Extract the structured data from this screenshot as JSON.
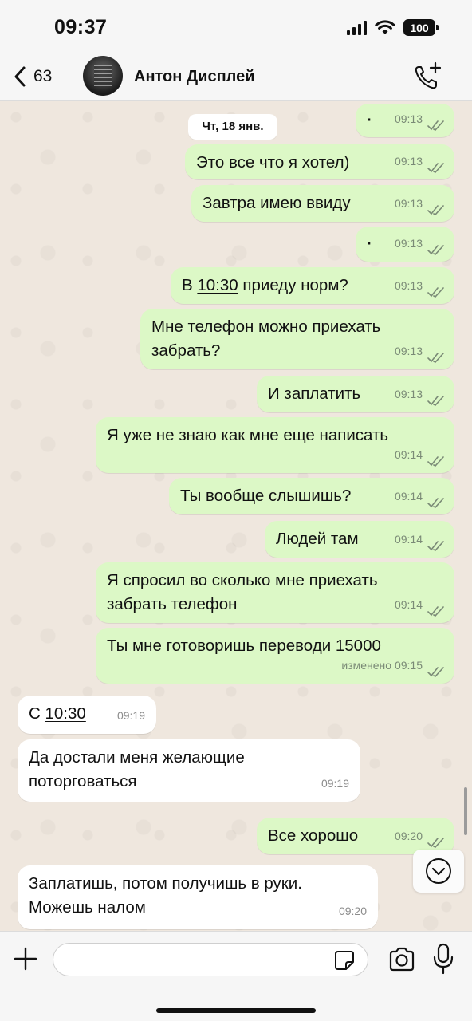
{
  "status_bar": {
    "time": "09:37",
    "battery": "100"
  },
  "header": {
    "back_count": "63",
    "contact_name": "Антон Дисплей"
  },
  "chat": {
    "date_separator": "Чт, 18 янв.",
    "messages": [
      {
        "dir": "out",
        "text": "·",
        "time": "09:13"
      },
      {
        "dir": "out",
        "text": "Это все что я хотел)",
        "time": "09:13"
      },
      {
        "dir": "out",
        "text": "Завтра имею ввиду",
        "time": "09:13"
      },
      {
        "dir": "out",
        "text": "·",
        "time": "09:13"
      },
      {
        "dir": "out",
        "text_before": "В ",
        "link": "10:30",
        "text_after": " приеду норм?",
        "time": "09:13"
      },
      {
        "dir": "out",
        "text": "Мне телефон можно приехать забрать?",
        "time": "09:13"
      },
      {
        "dir": "out",
        "text": "И заплатить",
        "time": "09:13"
      },
      {
        "dir": "out",
        "text": "Я уже не знаю как мне еще написать",
        "time": "09:14"
      },
      {
        "dir": "out",
        "text": "Ты вообще слышишь?",
        "time": "09:14"
      },
      {
        "dir": "out",
        "text": "Людей там",
        "time": "09:14"
      },
      {
        "dir": "out",
        "text": "Я спросил во сколько мне приехать забрать телефон",
        "time": "09:14"
      },
      {
        "dir": "out",
        "text": "Ты мне готоворишь переводи 15000",
        "time": "изменено 09:15"
      },
      {
        "dir": "in",
        "text_before": "С ",
        "link": "10:30",
        "time": "09:19"
      },
      {
        "dir": "in",
        "text": "Да достали меня желающие поторговаться",
        "time": "09:19"
      },
      {
        "dir": "out",
        "text": "Все хорошо",
        "time": "09:20"
      },
      {
        "dir": "in",
        "text": "Заплатишь, потом получишь в руки. Можешь налом",
        "time": "09:20"
      }
    ]
  },
  "input": {
    "value": "",
    "placeholder": ""
  },
  "colors": {
    "outgoing": "#dcf8c6",
    "incoming": "#ffffff",
    "background": "#efe7de",
    "ticks": "#7a8a76"
  }
}
